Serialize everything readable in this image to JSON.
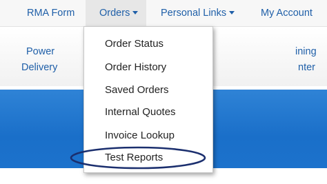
{
  "topnav": {
    "items": [
      {
        "label": "RMA Form"
      },
      {
        "label": "Orders"
      },
      {
        "label": "Personal Links"
      },
      {
        "label": "My Account"
      }
    ]
  },
  "subnav": {
    "left_line1": "Power",
    "left_line2": "Delivery",
    "right_line1": "ining",
    "right_line2": "nter"
  },
  "dropdown": {
    "items": [
      {
        "label": "Order Status"
      },
      {
        "label": "Order History"
      },
      {
        "label": "Saved Orders"
      },
      {
        "label": "Internal Quotes"
      },
      {
        "label": "Invoice Lookup"
      },
      {
        "label": "Test Reports"
      }
    ],
    "highlighted": "Test Reports"
  },
  "colors": {
    "link": "#1f5fa8",
    "band": "#1a6fc9",
    "oval": "#1b2f6e"
  }
}
